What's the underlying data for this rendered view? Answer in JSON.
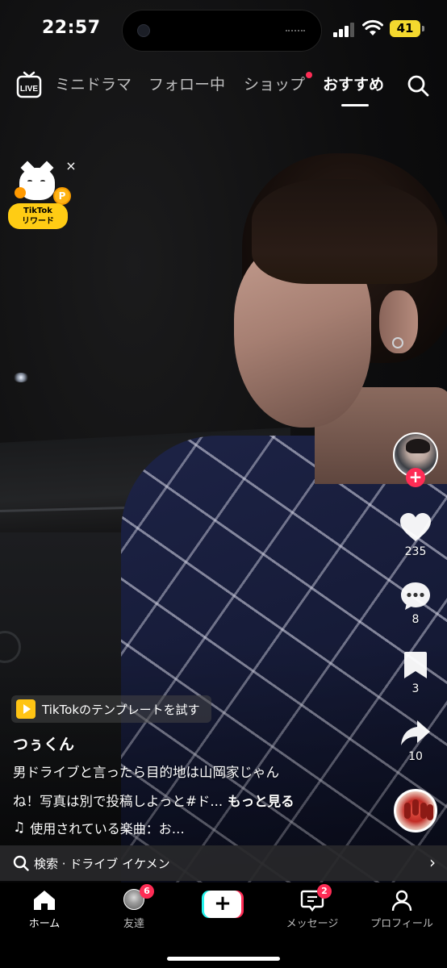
{
  "status_bar": {
    "time": "22:57",
    "battery": "41"
  },
  "top_nav": {
    "live_label": "LIVE",
    "tabs": [
      {
        "label": "ミニドラマ"
      },
      {
        "label": "フォロー中"
      },
      {
        "label": "ショップ"
      },
      {
        "label": "おすすめ"
      }
    ],
    "active_tab": "おすすめ"
  },
  "rewards": {
    "coin_letter": "P",
    "badge_line1": "TikTok",
    "badge_line2": "リワード",
    "close_glyph": "×"
  },
  "actions": {
    "follow_glyph": "+",
    "likes": "235",
    "comments": "8",
    "saves": "3",
    "shares": "10"
  },
  "caption": {
    "template_chip": "TikTokのテンプレートを試す",
    "username": "つぅくん",
    "line1": "男ドライブと言ったら目的地は山岡家じゃん",
    "line2": "ね！写真は別で投稿しよっと#ド...",
    "more": "もっと見る",
    "music_note": "♫",
    "music": "使用されている楽曲：お…"
  },
  "search_bar": {
    "text": "検索 · ドライブ イケメン",
    "chevron": "›"
  },
  "tab_bar": {
    "home": "ホーム",
    "friends": "友達",
    "friends_badge": "6",
    "create_glyph": "+",
    "messages": "メッセージ",
    "messages_badge": "2",
    "profile": "プロフィール"
  },
  "colors": {
    "accent_red": "#fe2c55",
    "accent_cyan": "#25f4ee",
    "battery_yellow": "#f4d92e",
    "rewards_yellow": "#ffcc14"
  },
  "icons": [
    "live-icon",
    "search-icon",
    "heart-icon",
    "comment-icon",
    "bookmark-icon",
    "share-icon",
    "music-note-icon",
    "home-icon",
    "inbox-icon",
    "profile-icon",
    "close-icon",
    "chevron-right-icon"
  ]
}
